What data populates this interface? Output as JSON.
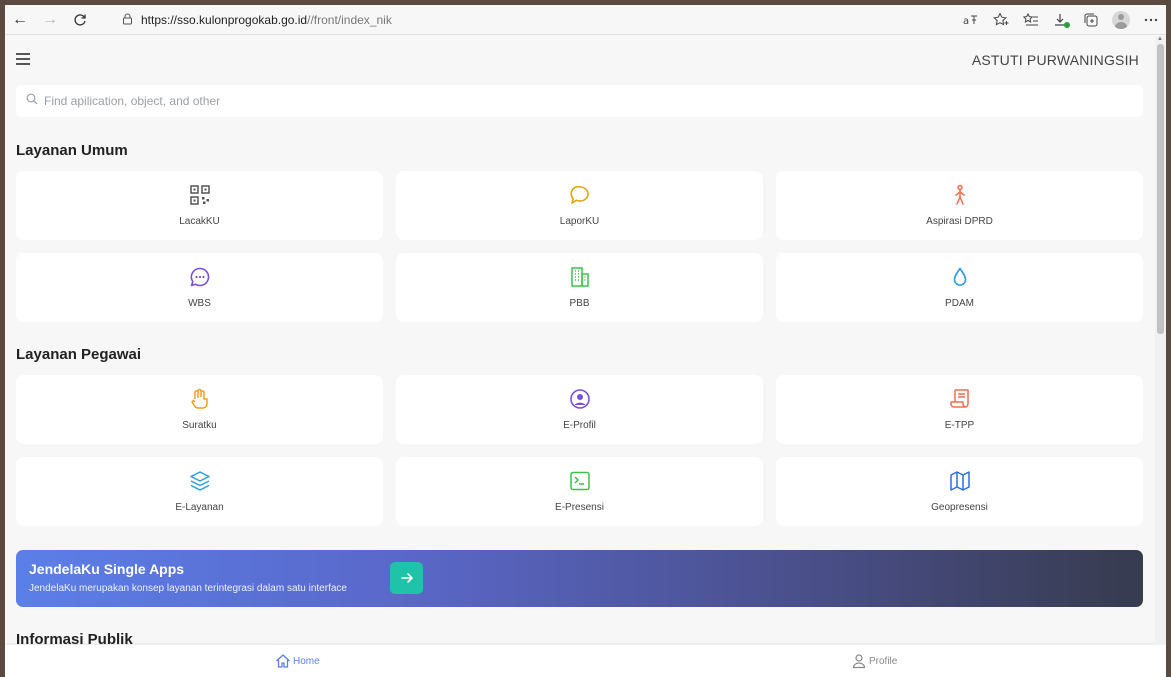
{
  "browser": {
    "url_host": "https://sso.kulonprogokab.go.id",
    "url_path": "//front/index_nik"
  },
  "header": {
    "username": "ASTUTI PURWANINGSIH"
  },
  "search": {
    "placeholder": "Find apilication, object, and other"
  },
  "sections": {
    "umum": {
      "title": "Layanan Umum",
      "items": [
        {
          "label": "LacakKU",
          "icon": "qr-code-icon",
          "color": "#555555"
        },
        {
          "label": "LaporKU",
          "icon": "chat-bubble-icon",
          "color": "#e0a514"
        },
        {
          "label": "Aspirasi DPRD",
          "icon": "walking-person-icon",
          "color": "#f26d4f"
        },
        {
          "label": "WBS",
          "icon": "message-dots-icon",
          "color": "#7b4de0"
        },
        {
          "label": "PBB",
          "icon": "building-icon",
          "color": "#3cc24a"
        },
        {
          "label": "PDAM",
          "icon": "water-drop-icon",
          "color": "#2d9be0"
        }
      ]
    },
    "pegawai": {
      "title": "Layanan Pegawai",
      "items": [
        {
          "label": "Suratku",
          "icon": "hand-icon",
          "color": "#f0a01e"
        },
        {
          "label": "E-Profil",
          "icon": "user-circle-icon",
          "color": "#7b4de0"
        },
        {
          "label": "E-TPP",
          "icon": "receipt-icon",
          "color": "#f26d4f"
        },
        {
          "label": "E-Layanan",
          "icon": "layers-icon",
          "color": "#2d9be0"
        },
        {
          "label": "E-Presensi",
          "icon": "terminal-icon",
          "color": "#3cc24a"
        },
        {
          "label": "Geopresensi",
          "icon": "map-icon",
          "color": "#2d6fe0"
        }
      ]
    },
    "publik": {
      "title": "Informasi Publik"
    }
  },
  "banner": {
    "title": "JendelaKu Single Apps",
    "subtitle": "JendelaKu merupakan konsep layanan terintegrasi dalam satu interface"
  },
  "bottom_nav": {
    "home": "Home",
    "profile": "Profile"
  },
  "colors": {
    "accent": "#5b7fe8",
    "teal": "#1fc3a7"
  }
}
